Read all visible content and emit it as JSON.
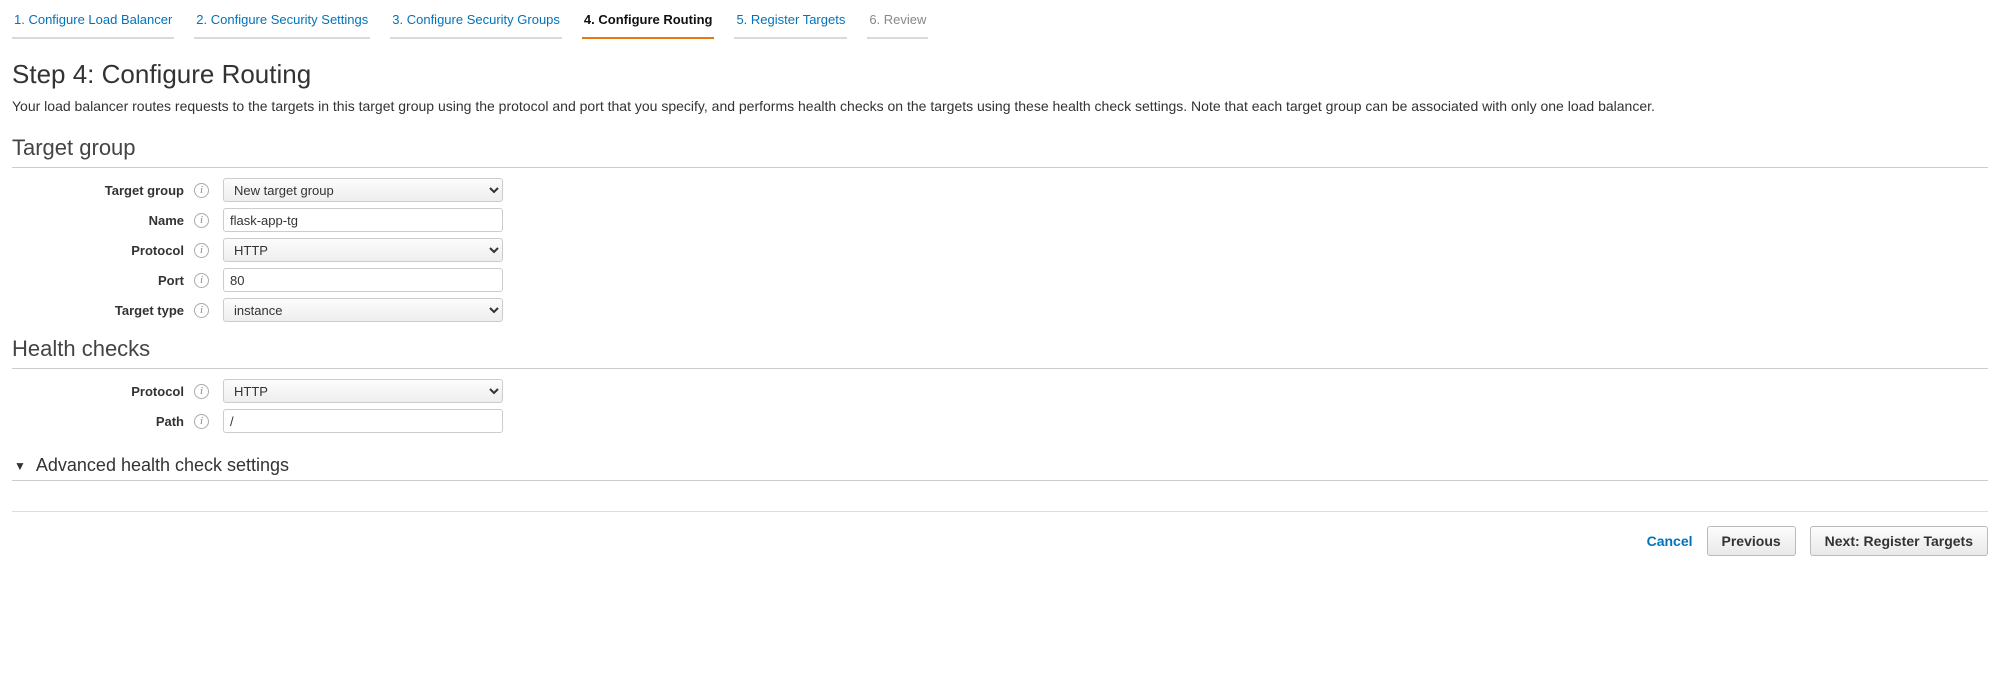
{
  "steps": {
    "s1": "1. Configure Load Balancer",
    "s2": "2. Configure Security Settings",
    "s3": "3. Configure Security Groups",
    "s4": "4. Configure Routing",
    "s5": "5. Register Targets",
    "s6": "6. Review"
  },
  "page": {
    "title": "Step 4: Configure Routing",
    "description": "Your load balancer routes requests to the targets in this target group using the protocol and port that you specify, and performs health checks on the targets using these health check settings. Note that each target group can be associated with only one load balancer."
  },
  "sections": {
    "target_group_title": "Target group",
    "health_checks_title": "Health checks"
  },
  "target_group": {
    "label_target_group": "Target group",
    "value_target_group": "New target group",
    "label_name": "Name",
    "value_name": "flask-app-tg",
    "label_protocol": "Protocol",
    "value_protocol": "HTTP",
    "label_port": "Port",
    "value_port": "80",
    "label_target_type": "Target type",
    "value_target_type": "instance"
  },
  "health_checks": {
    "label_protocol": "Protocol",
    "value_protocol": "HTTP",
    "label_path": "Path",
    "value_path": "/"
  },
  "advanced": {
    "label": "Advanced health check settings"
  },
  "footer": {
    "cancel": "Cancel",
    "previous": "Previous",
    "next": "Next: Register Targets"
  },
  "info_glyph": "i"
}
